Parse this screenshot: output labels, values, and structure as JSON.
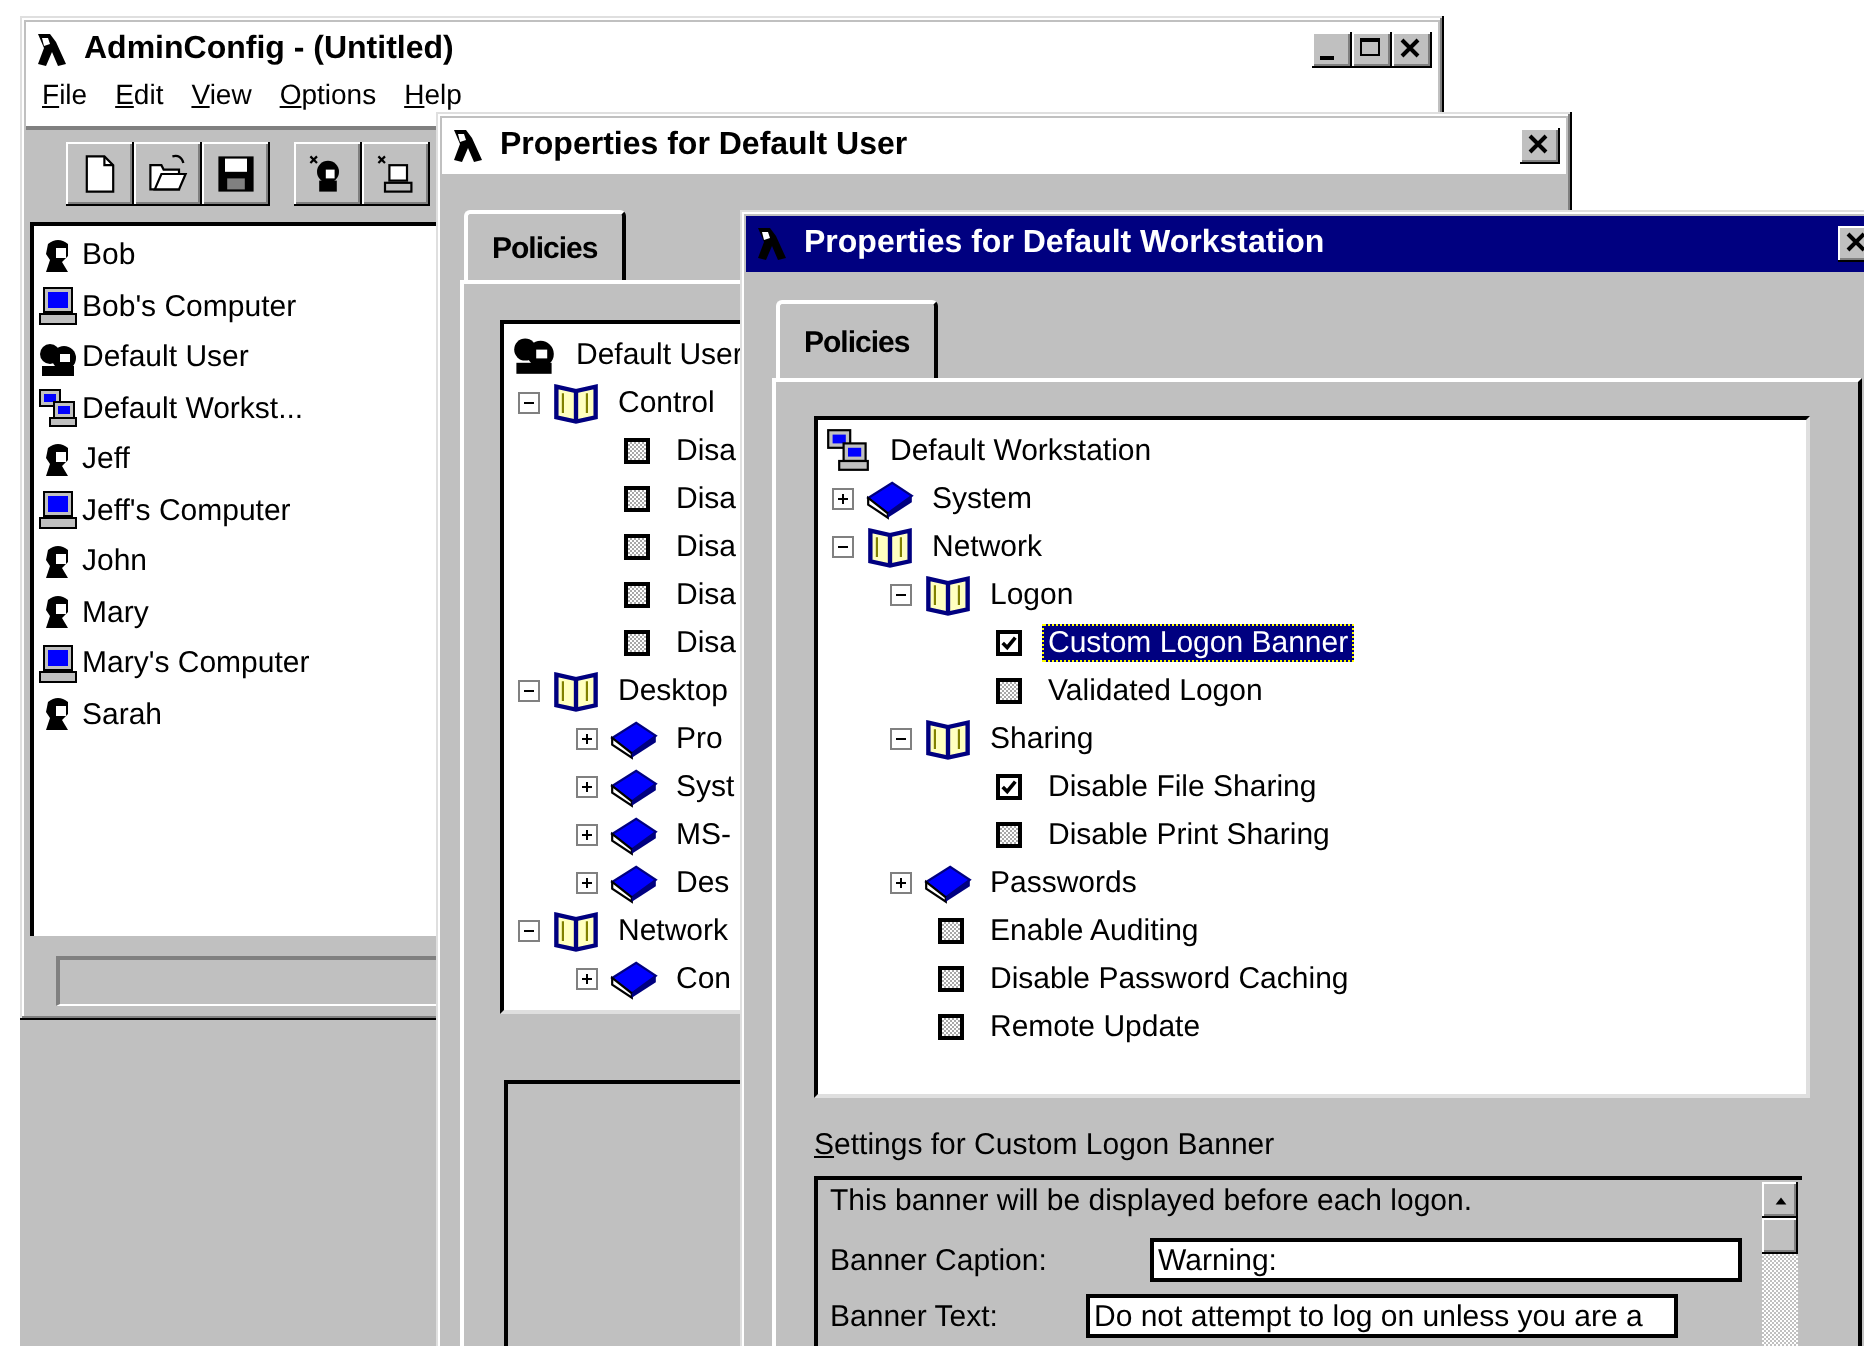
{
  "main_window": {
    "title": "AdminConfig - (Untitled)",
    "active": false,
    "menu": [
      "File",
      "Edit",
      "View",
      "Options",
      "Help"
    ],
    "items": [
      {
        "label": "Bob",
        "kind": "user"
      },
      {
        "label": "Bob's Computer",
        "kind": "computer"
      },
      {
        "label": "Default User",
        "kind": "group"
      },
      {
        "label": "Default Workst...",
        "kind": "workstation"
      },
      {
        "label": "Jeff",
        "kind": "user"
      },
      {
        "label": "Jeff's Computer",
        "kind": "computer"
      },
      {
        "label": "John",
        "kind": "user"
      },
      {
        "label": "Mary",
        "kind": "user"
      },
      {
        "label": "Mary's Computer",
        "kind": "computer"
      },
      {
        "label": "Sarah",
        "kind": "user"
      }
    ]
  },
  "user_window": {
    "title": "Properties for Default User",
    "active": false,
    "tab": {
      "label": "Policies",
      "selected": true
    },
    "tree": {
      "label": "Default User",
      "kind": "group",
      "selected": false,
      "children": [
        {
          "label": "Control",
          "kind": "category",
          "expanded": true,
          "selected": false,
          "children": [
            {
              "label": "Disa",
              "kind": "policy",
              "checked": false,
              "selected": false
            },
            {
              "label": "Disa",
              "kind": "policy",
              "checked": false,
              "selected": false
            },
            {
              "label": "Disa",
              "kind": "policy",
              "checked": false,
              "selected": false
            },
            {
              "label": "Disa",
              "kind": "policy",
              "checked": false,
              "selected": false
            },
            {
              "label": "Disa",
              "kind": "policy",
              "checked": false,
              "selected": false
            }
          ]
        },
        {
          "label": "Desktop",
          "kind": "category",
          "expanded": true,
          "selected": false,
          "children": [
            {
              "label": "Pro",
              "kind": "category",
              "expanded": false,
              "selected": false
            },
            {
              "label": "Syst",
              "kind": "category",
              "expanded": false,
              "selected": false
            },
            {
              "label": "MS-",
              "kind": "category",
              "expanded": false,
              "selected": false
            },
            {
              "label": "Des",
              "kind": "category",
              "expanded": false,
              "selected": false
            }
          ]
        },
        {
          "label": "Network",
          "kind": "category",
          "expanded": true,
          "selected": false,
          "children": [
            {
              "label": "Con",
              "kind": "category",
              "expanded": false,
              "selected": false
            }
          ]
        }
      ]
    }
  },
  "workstation_window": {
    "title": "Properties for Default Workstation",
    "active": true,
    "tab": {
      "label": "Policies",
      "selected": true
    },
    "tree": {
      "label": "Default Workstation",
      "kind": "workstation",
      "selected": false,
      "children": [
        {
          "label": "System",
          "kind": "category",
          "expanded": false,
          "selected": false
        },
        {
          "label": "Network",
          "kind": "category",
          "expanded": true,
          "selected": false,
          "children": [
            {
              "label": "Logon",
              "kind": "category",
              "expanded": true,
              "selected": false,
              "children": [
                {
                  "label": "Custom Logon Banner",
                  "kind": "policy",
                  "checked": true,
                  "selected": true
                },
                {
                  "label": "Validated Logon",
                  "kind": "policy",
                  "checked": false,
                  "selected": false
                }
              ]
            },
            {
              "label": "Sharing",
              "kind": "category",
              "expanded": true,
              "selected": false,
              "children": [
                {
                  "label": "Disable File Sharing",
                  "kind": "policy",
                  "checked": true,
                  "selected": false
                },
                {
                  "label": "Disable Print Sharing",
                  "kind": "policy",
                  "checked": false,
                  "selected": false
                }
              ]
            },
            {
              "label": "Passwords",
              "kind": "category",
              "expanded": false,
              "selected": false
            },
            {
              "label": "Enable Auditing",
              "kind": "policy",
              "checked": false,
              "selected": false
            },
            {
              "label": "Disable Password Caching",
              "kind": "policy",
              "checked": false,
              "selected": false
            },
            {
              "label": "Remote Update",
              "kind": "policy",
              "checked": false,
              "selected": false
            }
          ]
        }
      ]
    },
    "settings": {
      "label": "Settings for Custom Logon Banner",
      "description": "This banner will be displayed before each logon.",
      "fields": [
        {
          "label": "Banner Caption:",
          "value": "Warning:"
        },
        {
          "label": "Banner Text:",
          "value": "Do not attempt to log on unless you are a"
        }
      ]
    }
  }
}
